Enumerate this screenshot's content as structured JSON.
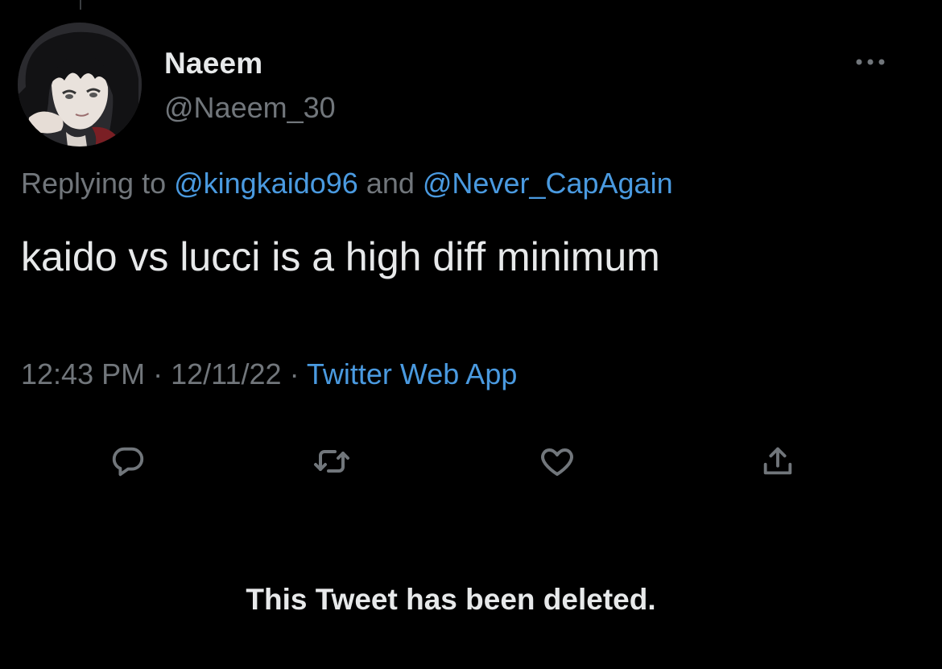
{
  "tweet": {
    "author": {
      "display_name": "Naeem",
      "handle": "@Naeem_30",
      "avatar_icon": "anime-avatar"
    },
    "more_icon": "more-horizontal-icon",
    "replying_prefix": "Replying to ",
    "reply_mentions": [
      "@kingkaido96",
      "@Never_CapAgain"
    ],
    "reply_joiner": " and ",
    "text": "kaido vs lucci is a high diff minimum",
    "time": "12:43 PM",
    "date": "12/11/22",
    "separator": " · ",
    "source": "Twitter Web App",
    "actions": [
      {
        "name": "reply",
        "icon": "reply-icon"
      },
      {
        "name": "retweet",
        "icon": "retweet-icon"
      },
      {
        "name": "like",
        "icon": "heart-icon"
      },
      {
        "name": "share",
        "icon": "share-icon"
      }
    ]
  },
  "deleted_notice": "This Tweet has been deleted.",
  "colors": {
    "background": "#000000",
    "primary_text": "#e7e9ea",
    "secondary_text": "#71767b",
    "link": "#4a9ae0"
  }
}
